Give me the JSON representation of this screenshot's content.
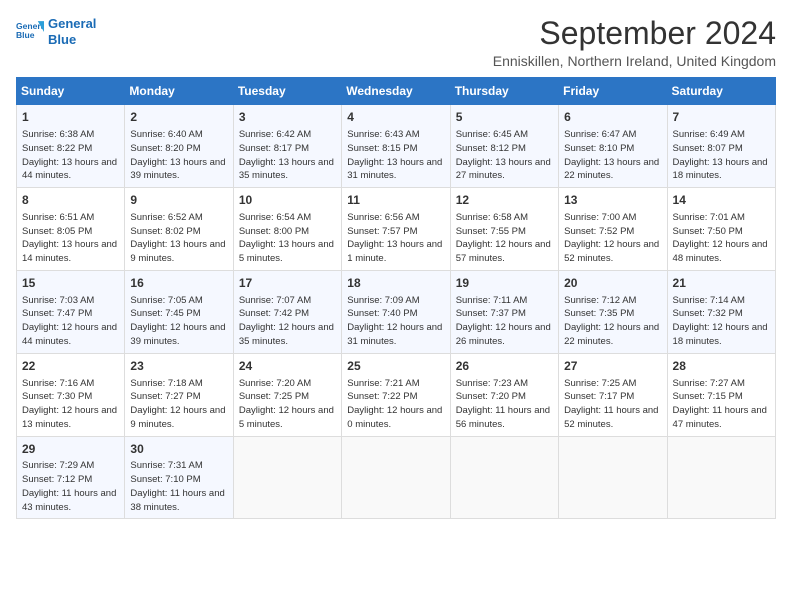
{
  "logo": {
    "line1": "General",
    "line2": "Blue"
  },
  "title": "September 2024",
  "subtitle": "Enniskillen, Northern Ireland, United Kingdom",
  "weekdays": [
    "Sunday",
    "Monday",
    "Tuesday",
    "Wednesday",
    "Thursday",
    "Friday",
    "Saturday"
  ],
  "weeks": [
    [
      {
        "day": "1",
        "sunrise": "6:38 AM",
        "sunset": "8:22 PM",
        "daylight": "13 hours and 44 minutes."
      },
      {
        "day": "2",
        "sunrise": "6:40 AM",
        "sunset": "8:20 PM",
        "daylight": "13 hours and 39 minutes."
      },
      {
        "day": "3",
        "sunrise": "6:42 AM",
        "sunset": "8:17 PM",
        "daylight": "13 hours and 35 minutes."
      },
      {
        "day": "4",
        "sunrise": "6:43 AM",
        "sunset": "8:15 PM",
        "daylight": "13 hours and 31 minutes."
      },
      {
        "day": "5",
        "sunrise": "6:45 AM",
        "sunset": "8:12 PM",
        "daylight": "13 hours and 27 minutes."
      },
      {
        "day": "6",
        "sunrise": "6:47 AM",
        "sunset": "8:10 PM",
        "daylight": "13 hours and 22 minutes."
      },
      {
        "day": "7",
        "sunrise": "6:49 AM",
        "sunset": "8:07 PM",
        "daylight": "13 hours and 18 minutes."
      }
    ],
    [
      {
        "day": "8",
        "sunrise": "6:51 AM",
        "sunset": "8:05 PM",
        "daylight": "13 hours and 14 minutes."
      },
      {
        "day": "9",
        "sunrise": "6:52 AM",
        "sunset": "8:02 PM",
        "daylight": "13 hours and 9 minutes."
      },
      {
        "day": "10",
        "sunrise": "6:54 AM",
        "sunset": "8:00 PM",
        "daylight": "13 hours and 5 minutes."
      },
      {
        "day": "11",
        "sunrise": "6:56 AM",
        "sunset": "7:57 PM",
        "daylight": "13 hours and 1 minute."
      },
      {
        "day": "12",
        "sunrise": "6:58 AM",
        "sunset": "7:55 PM",
        "daylight": "12 hours and 57 minutes."
      },
      {
        "day": "13",
        "sunrise": "7:00 AM",
        "sunset": "7:52 PM",
        "daylight": "12 hours and 52 minutes."
      },
      {
        "day": "14",
        "sunrise": "7:01 AM",
        "sunset": "7:50 PM",
        "daylight": "12 hours and 48 minutes."
      }
    ],
    [
      {
        "day": "15",
        "sunrise": "7:03 AM",
        "sunset": "7:47 PM",
        "daylight": "12 hours and 44 minutes."
      },
      {
        "day": "16",
        "sunrise": "7:05 AM",
        "sunset": "7:45 PM",
        "daylight": "12 hours and 39 minutes."
      },
      {
        "day": "17",
        "sunrise": "7:07 AM",
        "sunset": "7:42 PM",
        "daylight": "12 hours and 35 minutes."
      },
      {
        "day": "18",
        "sunrise": "7:09 AM",
        "sunset": "7:40 PM",
        "daylight": "12 hours and 31 minutes."
      },
      {
        "day": "19",
        "sunrise": "7:11 AM",
        "sunset": "7:37 PM",
        "daylight": "12 hours and 26 minutes."
      },
      {
        "day": "20",
        "sunrise": "7:12 AM",
        "sunset": "7:35 PM",
        "daylight": "12 hours and 22 minutes."
      },
      {
        "day": "21",
        "sunrise": "7:14 AM",
        "sunset": "7:32 PM",
        "daylight": "12 hours and 18 minutes."
      }
    ],
    [
      {
        "day": "22",
        "sunrise": "7:16 AM",
        "sunset": "7:30 PM",
        "daylight": "12 hours and 13 minutes."
      },
      {
        "day": "23",
        "sunrise": "7:18 AM",
        "sunset": "7:27 PM",
        "daylight": "12 hours and 9 minutes."
      },
      {
        "day": "24",
        "sunrise": "7:20 AM",
        "sunset": "7:25 PM",
        "daylight": "12 hours and 5 minutes."
      },
      {
        "day": "25",
        "sunrise": "7:21 AM",
        "sunset": "7:22 PM",
        "daylight": "12 hours and 0 minutes."
      },
      {
        "day": "26",
        "sunrise": "7:23 AM",
        "sunset": "7:20 PM",
        "daylight": "11 hours and 56 minutes."
      },
      {
        "day": "27",
        "sunrise": "7:25 AM",
        "sunset": "7:17 PM",
        "daylight": "11 hours and 52 minutes."
      },
      {
        "day": "28",
        "sunrise": "7:27 AM",
        "sunset": "7:15 PM",
        "daylight": "11 hours and 47 minutes."
      }
    ],
    [
      {
        "day": "29",
        "sunrise": "7:29 AM",
        "sunset": "7:12 PM",
        "daylight": "11 hours and 43 minutes."
      },
      {
        "day": "30",
        "sunrise": "7:31 AM",
        "sunset": "7:10 PM",
        "daylight": "11 hours and 38 minutes."
      },
      null,
      null,
      null,
      null,
      null
    ]
  ]
}
